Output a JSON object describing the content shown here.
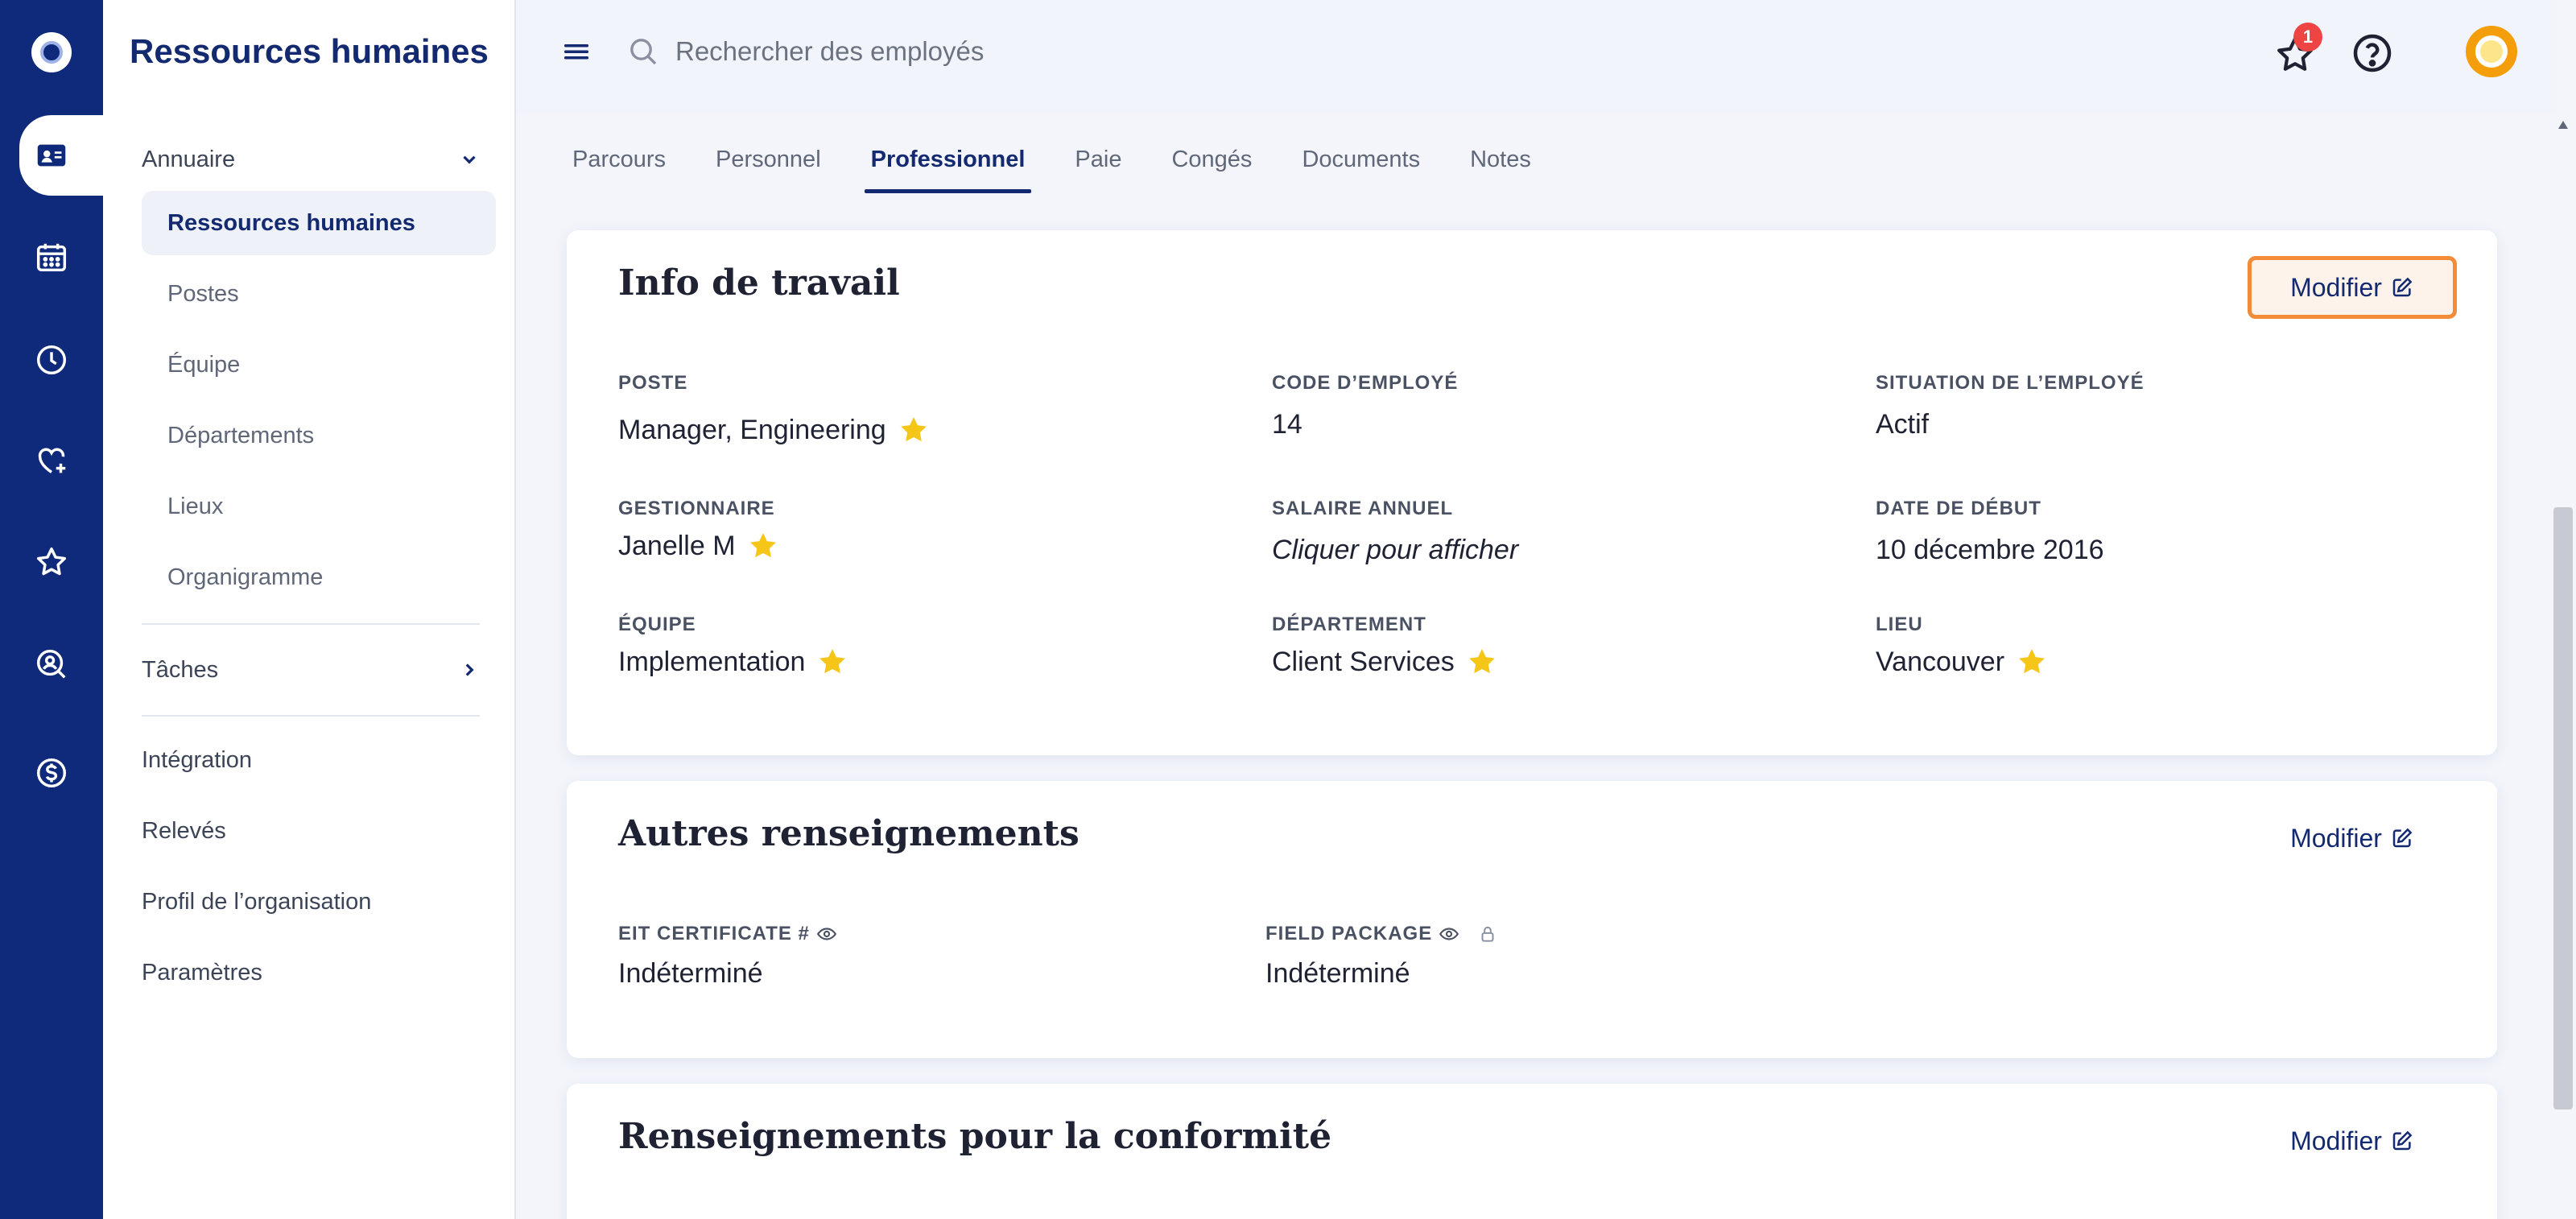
{
  "sidebar": {
    "title": "Ressources humaines",
    "directory": {
      "label": "Annuaire",
      "items": [
        "Ressources humaines",
        "Postes",
        "Équipe",
        "Départements",
        "Lieux",
        "Organigramme"
      ]
    },
    "tasks_label": "Tâches",
    "other_items": [
      "Intégration",
      "Relevés",
      "Profil de l’organisation",
      "Paramètres"
    ]
  },
  "topbar": {
    "search_placeholder": "Rechercher des employés",
    "notification_count": "1"
  },
  "tabs": [
    "Parcours",
    "Personnel",
    "Professionnel",
    "Paie",
    "Congés",
    "Documents",
    "Notes"
  ],
  "active_tab": "Professionnel",
  "work_info": {
    "title": "Info de travail",
    "edit_label": "Modifier",
    "fields": {
      "position": {
        "label": "POSTE",
        "value": "Manager, Engineering"
      },
      "employee_code": {
        "label": "CODE D’EMPLOYÉ",
        "value": "14"
      },
      "employee_status": {
        "label": "SITUATION DE L’EMPLOYÉ",
        "value": "Actif"
      },
      "manager": {
        "label": "GESTIONNAIRE",
        "value": "Janelle M"
      },
      "annual_salary": {
        "label": "SALAIRE ANNUEL",
        "value": "Cliquer pour afficher"
      },
      "start_date": {
        "label": "DATE DE DÉBUT",
        "value": "10 décembre 2016"
      },
      "team": {
        "label": "ÉQUIPE",
        "value": "Implementation"
      },
      "department": {
        "label": "DÉPARTEMENT",
        "value": "Client Services"
      },
      "location": {
        "label": "LIEU",
        "value": "Vancouver"
      }
    }
  },
  "other_info": {
    "title": "Autres renseignements",
    "edit_label": "Modifier",
    "fields": {
      "eit_certificate": {
        "label": "EIT CERTIFICATE #",
        "value": "Indéterminé"
      },
      "field_package": {
        "label": "FIELD PACKAGE",
        "value": "Indéterminé"
      }
    }
  },
  "compliance": {
    "title": "Renseignements pour la conformité",
    "edit_label": "Modifier"
  },
  "colors": {
    "brand_navy": "#0f2a7a",
    "focus_orange": "#f28c38",
    "star_yellow": "#f5c518",
    "badge_red": "#ef4444"
  }
}
